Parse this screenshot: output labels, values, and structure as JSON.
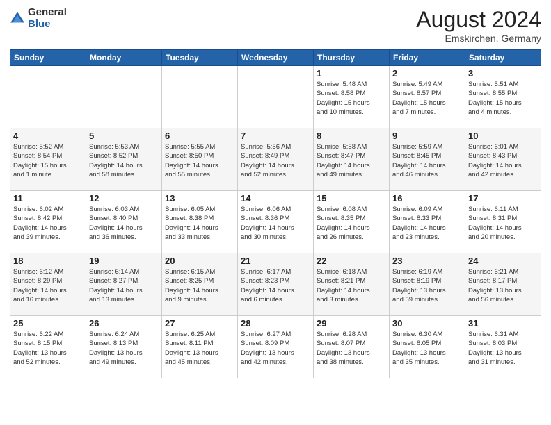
{
  "logo": {
    "general": "General",
    "blue": "Blue"
  },
  "header": {
    "month_year": "August 2024",
    "location": "Emskirchen, Germany"
  },
  "weekdays": [
    "Sunday",
    "Monday",
    "Tuesday",
    "Wednesday",
    "Thursday",
    "Friday",
    "Saturday"
  ],
  "weeks": [
    [
      {
        "day": "",
        "info": ""
      },
      {
        "day": "",
        "info": ""
      },
      {
        "day": "",
        "info": ""
      },
      {
        "day": "",
        "info": ""
      },
      {
        "day": "1",
        "info": "Sunrise: 5:48 AM\nSunset: 8:58 PM\nDaylight: 15 hours\nand 10 minutes."
      },
      {
        "day": "2",
        "info": "Sunrise: 5:49 AM\nSunset: 8:57 PM\nDaylight: 15 hours\nand 7 minutes."
      },
      {
        "day": "3",
        "info": "Sunrise: 5:51 AM\nSunset: 8:55 PM\nDaylight: 15 hours\nand 4 minutes."
      }
    ],
    [
      {
        "day": "4",
        "info": "Sunrise: 5:52 AM\nSunset: 8:54 PM\nDaylight: 15 hours\nand 1 minute."
      },
      {
        "day": "5",
        "info": "Sunrise: 5:53 AM\nSunset: 8:52 PM\nDaylight: 14 hours\nand 58 minutes."
      },
      {
        "day": "6",
        "info": "Sunrise: 5:55 AM\nSunset: 8:50 PM\nDaylight: 14 hours\nand 55 minutes."
      },
      {
        "day": "7",
        "info": "Sunrise: 5:56 AM\nSunset: 8:49 PM\nDaylight: 14 hours\nand 52 minutes."
      },
      {
        "day": "8",
        "info": "Sunrise: 5:58 AM\nSunset: 8:47 PM\nDaylight: 14 hours\nand 49 minutes."
      },
      {
        "day": "9",
        "info": "Sunrise: 5:59 AM\nSunset: 8:45 PM\nDaylight: 14 hours\nand 46 minutes."
      },
      {
        "day": "10",
        "info": "Sunrise: 6:01 AM\nSunset: 8:43 PM\nDaylight: 14 hours\nand 42 minutes."
      }
    ],
    [
      {
        "day": "11",
        "info": "Sunrise: 6:02 AM\nSunset: 8:42 PM\nDaylight: 14 hours\nand 39 minutes."
      },
      {
        "day": "12",
        "info": "Sunrise: 6:03 AM\nSunset: 8:40 PM\nDaylight: 14 hours\nand 36 minutes."
      },
      {
        "day": "13",
        "info": "Sunrise: 6:05 AM\nSunset: 8:38 PM\nDaylight: 14 hours\nand 33 minutes."
      },
      {
        "day": "14",
        "info": "Sunrise: 6:06 AM\nSunset: 8:36 PM\nDaylight: 14 hours\nand 30 minutes."
      },
      {
        "day": "15",
        "info": "Sunrise: 6:08 AM\nSunset: 8:35 PM\nDaylight: 14 hours\nand 26 minutes."
      },
      {
        "day": "16",
        "info": "Sunrise: 6:09 AM\nSunset: 8:33 PM\nDaylight: 14 hours\nand 23 minutes."
      },
      {
        "day": "17",
        "info": "Sunrise: 6:11 AM\nSunset: 8:31 PM\nDaylight: 14 hours\nand 20 minutes."
      }
    ],
    [
      {
        "day": "18",
        "info": "Sunrise: 6:12 AM\nSunset: 8:29 PM\nDaylight: 14 hours\nand 16 minutes."
      },
      {
        "day": "19",
        "info": "Sunrise: 6:14 AM\nSunset: 8:27 PM\nDaylight: 14 hours\nand 13 minutes."
      },
      {
        "day": "20",
        "info": "Sunrise: 6:15 AM\nSunset: 8:25 PM\nDaylight: 14 hours\nand 9 minutes."
      },
      {
        "day": "21",
        "info": "Sunrise: 6:17 AM\nSunset: 8:23 PM\nDaylight: 14 hours\nand 6 minutes."
      },
      {
        "day": "22",
        "info": "Sunrise: 6:18 AM\nSunset: 8:21 PM\nDaylight: 14 hours\nand 3 minutes."
      },
      {
        "day": "23",
        "info": "Sunrise: 6:19 AM\nSunset: 8:19 PM\nDaylight: 13 hours\nand 59 minutes."
      },
      {
        "day": "24",
        "info": "Sunrise: 6:21 AM\nSunset: 8:17 PM\nDaylight: 13 hours\nand 56 minutes."
      }
    ],
    [
      {
        "day": "25",
        "info": "Sunrise: 6:22 AM\nSunset: 8:15 PM\nDaylight: 13 hours\nand 52 minutes."
      },
      {
        "day": "26",
        "info": "Sunrise: 6:24 AM\nSunset: 8:13 PM\nDaylight: 13 hours\nand 49 minutes."
      },
      {
        "day": "27",
        "info": "Sunrise: 6:25 AM\nSunset: 8:11 PM\nDaylight: 13 hours\nand 45 minutes."
      },
      {
        "day": "28",
        "info": "Sunrise: 6:27 AM\nSunset: 8:09 PM\nDaylight: 13 hours\nand 42 minutes."
      },
      {
        "day": "29",
        "info": "Sunrise: 6:28 AM\nSunset: 8:07 PM\nDaylight: 13 hours\nand 38 minutes."
      },
      {
        "day": "30",
        "info": "Sunrise: 6:30 AM\nSunset: 8:05 PM\nDaylight: 13 hours\nand 35 minutes."
      },
      {
        "day": "31",
        "info": "Sunrise: 6:31 AM\nSunset: 8:03 PM\nDaylight: 13 hours\nand 31 minutes."
      }
    ]
  ]
}
